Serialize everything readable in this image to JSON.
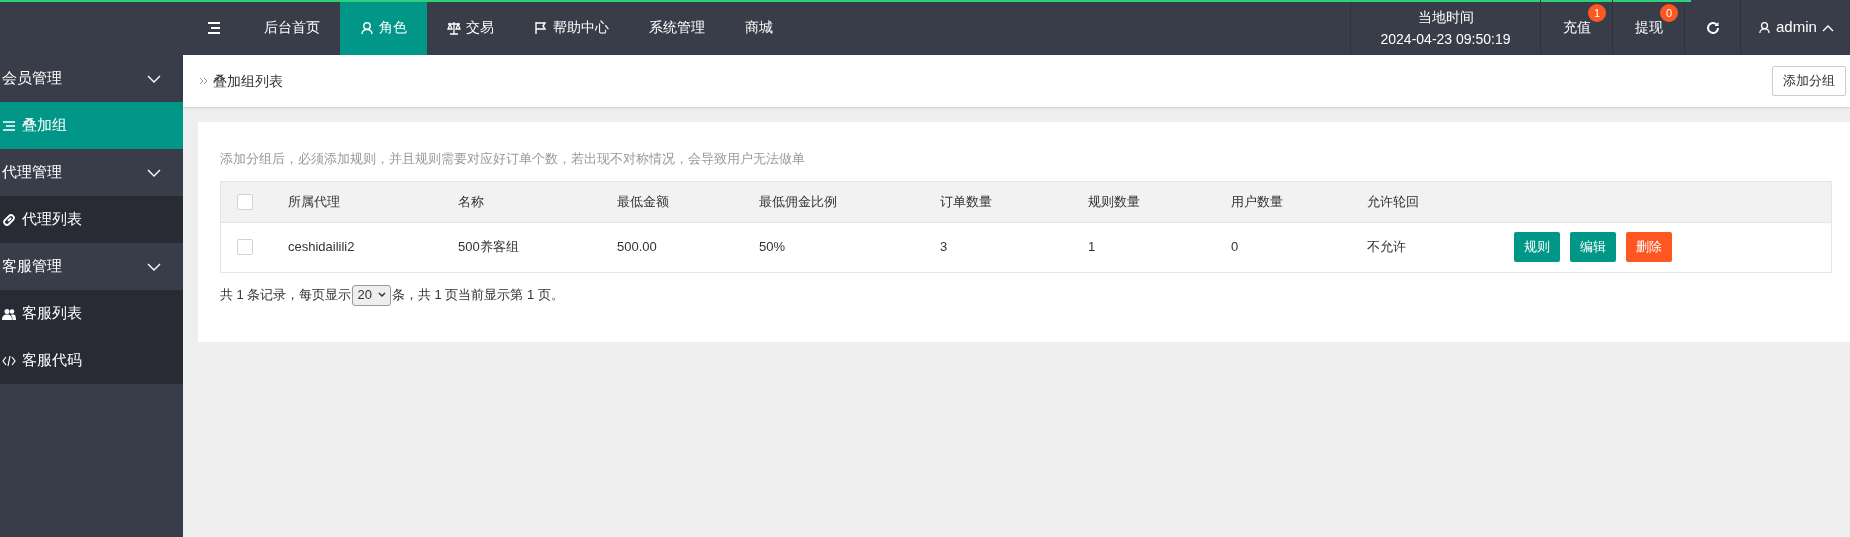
{
  "loading_bar": {
    "level": 0.914
  },
  "top_nav": {
    "tabs": [
      {
        "label": "后台首页",
        "selected": false
      },
      {
        "label": "角色",
        "selected": true
      },
      {
        "label": "交易",
        "selected": false
      },
      {
        "label": "帮助中心",
        "selected": false
      },
      {
        "label": "系统管理",
        "selected": false
      },
      {
        "label": "商城",
        "selected": false
      }
    ],
    "clock": {
      "label": "当地时间",
      "value": "2024-04-23 09:50:19"
    },
    "actions": [
      {
        "label": "充值",
        "badge": "1"
      },
      {
        "label": "提现",
        "badge": "0"
      }
    ],
    "user": "admin"
  },
  "sidebar": {
    "groups": [
      {
        "label": "会员管理",
        "children": [
          {
            "label": "叠加组",
            "selected": true
          }
        ]
      },
      {
        "label": "代理管理",
        "children": [
          {
            "label": "代理列表",
            "selected": false
          }
        ]
      },
      {
        "label": "客服管理",
        "children": [
          {
            "label": "客服列表",
            "selected": false
          },
          {
            "label": "客服代码",
            "selected": false
          }
        ]
      }
    ]
  },
  "breadcrumb": "叠加组列表",
  "add_button": "添加分组",
  "hint": "添加分组后，必须添加规则，并且规则需要对应好订单个数，若出现不对称情况，会导致用户无法做单",
  "table": {
    "columns": [
      "所属代理",
      "名称",
      "最低金额",
      "最低佣金比例",
      "订单数量",
      "规则数量",
      "用户数量",
      "允许轮回"
    ],
    "header_checked": false,
    "rows": [
      {
        "checked": false,
        "cells": [
          "ceshidailili2",
          "500养客组",
          "500.00",
          "50%",
          "3",
          "1",
          "0",
          "不允许"
        ],
        "actions": [
          {
            "label": "规则",
            "kind": "primary"
          },
          {
            "label": "编辑",
            "kind": "primary"
          },
          {
            "label": "删除",
            "kind": "danger"
          }
        ]
      }
    ]
  },
  "pagination": {
    "before": "共 1 条记录，每页显示",
    "page_size": "20",
    "after": "条，共 1 页当前显示第 1 页。"
  }
}
